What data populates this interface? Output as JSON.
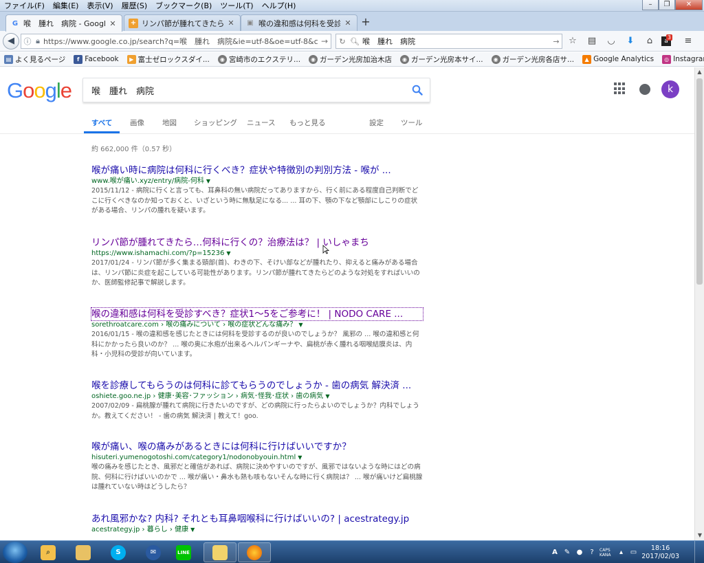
{
  "menubar": [
    "ファイル(F)",
    "編集(E)",
    "表示(V)",
    "履歴(S)",
    "ブックマーク(B)",
    "ツール(T)",
    "ヘルプ(H)"
  ],
  "tabs": [
    {
      "title": "喉　腫れ　病院 - Google...",
      "icon": "G",
      "active": true
    },
    {
      "title": "リンパ節が腫れてきたら...",
      "icon": "+",
      "active": false
    },
    {
      "title": "喉の違和感は何科を受診...",
      "icon": "▣",
      "active": false
    }
  ],
  "navbar": {
    "url": "https://www.google.co.jp/search?q=喉　腫れ　病院&ie=utf-8&oe=utf-8&clien",
    "search_text": "喉　腫れ　病院"
  },
  "bookmarks": [
    {
      "label": "よく見るページ",
      "color": "#5b7fb8"
    },
    {
      "label": "Facebook",
      "color": "#3b5998",
      "icon": "f"
    },
    {
      "label": "富士ゼロックスダイ...",
      "color": "#f0a030"
    },
    {
      "label": "宮崎市のエクステリ...",
      "color": "#777777"
    },
    {
      "label": "ガーデン光房加治木店",
      "color": "#777777"
    },
    {
      "label": "ガーデン光房本サイ...",
      "color": "#777777"
    },
    {
      "label": "ガーデン光房各店サ...",
      "color": "#777777"
    },
    {
      "label": "Google Analytics",
      "color": "#f57c00"
    },
    {
      "label": "Instagram",
      "color": "#c13584"
    }
  ],
  "google": {
    "logo": "Google",
    "query": "喉　腫れ　病院",
    "avatar_letter": "k",
    "tabs": [
      {
        "label": "すべて",
        "active": true
      },
      {
        "label": "画像"
      },
      {
        "label": "地図"
      },
      {
        "label": "ショッピング"
      },
      {
        "label": "ニュース"
      },
      {
        "label": "もっと見る"
      },
      {
        "label": "設定"
      },
      {
        "label": "ツール"
      }
    ],
    "stats": "約 662,000 件（0.57 秒）",
    "results": [
      {
        "title": "喉が痛い時に病院は何科に行くべき？症状や特徴別の判別方法 - 喉が ...",
        "url": "www.喉が痛い.xyz/entry/病院-何科",
        "snippet": "2015/11/12 - 病院に行くと言っても、耳鼻科の無い病院だってありますから、行く前にある程度自己判断でどこに行くべきなのか知っておくと、いざという時に無駄足になる... ... 耳の下、顎の下など顎部にしこりの症状がある場合、リンパの腫れを疑います。",
        "state": "unvisited"
      },
      {
        "title": "リンパ節が腫れてきたら…何科に行くの？治療法は？ | いしゃまち",
        "url": "https://www.ishamachi.com/?p=15236",
        "snippet": "2017/01/24 - リンパ節が多く集まる頸部(首)、わきの下、そけい部などが腫れたり、抑えると痛みがある場合は、リンパ節に炎症を起こしている可能性があります。リンパ節が腫れてきたらどのような対処をすればいいのか、医師監修記事で解説します。",
        "state": "visited"
      },
      {
        "title": "喉の違和感は何科を受診すべき？症状1～5をご参考に！ | NODO CARE ...",
        "url": "sorethroatcare.com › 喉の痛みについて › 喉の症状どんな痛み？",
        "snippet": "2016/01/15 - 喉の違和感を感じたときには何科を受診するのが良いのでしょうか？ 風邪の ... 喉の違和感と何科にかかったら良いのか？ ... 喉の奥に水疱が出来るヘルパンギーナや、扁桃が赤く腫れる咽喉結膜炎は、内科・小児科の受診が向いています。",
        "state": "focused"
      },
      {
        "title": "喉を診療してもらうのは何科に診てもらうのでしょうか - 歯の病気 解決済 ...",
        "url": "oshiete.goo.ne.jp › 健康･美容･ファッション › 病気･怪我･症状 › 歯の病気",
        "snippet": "2007/02/09 - 扁桃腺が腫れて病院に行きたいのですが、どの病院に行ったらよいのでしょうか？内科でしょうか。教えてください！ - 歯の病気 解決済 | 教えて！goo.",
        "state": "unvisited"
      },
      {
        "title": "喉が痛い、喉の痛みがあるときには何科に行けばいいですか？",
        "url": "hisuteri.yumenogotoshi.com/category1/nodonobyouin.html",
        "snippet": "喉の痛みを感じたとき、風邪だと確信があれば、病院に決めやすいのですが、風邪ではないような時にはどの病院、何科に行けばいいのかで ... 喉が痛い・鼻水も熱も咳もないそんな時に行く病院は？ ... 喉が痛いけど扁桃腺は腫れていない時はどうしたら？",
        "state": "unvisited"
      },
      {
        "title": "あれ風邪かな? 内科? それとも耳鼻咽喉科に行けばいいの? | acestrategy.jp",
        "url": "acestrategy.jp › 暮らし › 健康",
        "snippet": "",
        "state": "unvisited"
      }
    ]
  },
  "taskbar": {
    "apps": [
      "search",
      "explorer",
      "skype",
      "thunderbird",
      "line",
      "folder",
      "firefox"
    ],
    "caps": "CAPS",
    "kana": "KANA",
    "time": "18:16",
    "date": "2017/02/03"
  },
  "colors": {
    "google_blue": "#4285F4",
    "google_red": "#EA4335",
    "google_yellow": "#FBBC05",
    "google_green": "#34A853",
    "link": "#1a0dab",
    "visited": "#660099",
    "url_green": "#006621"
  }
}
